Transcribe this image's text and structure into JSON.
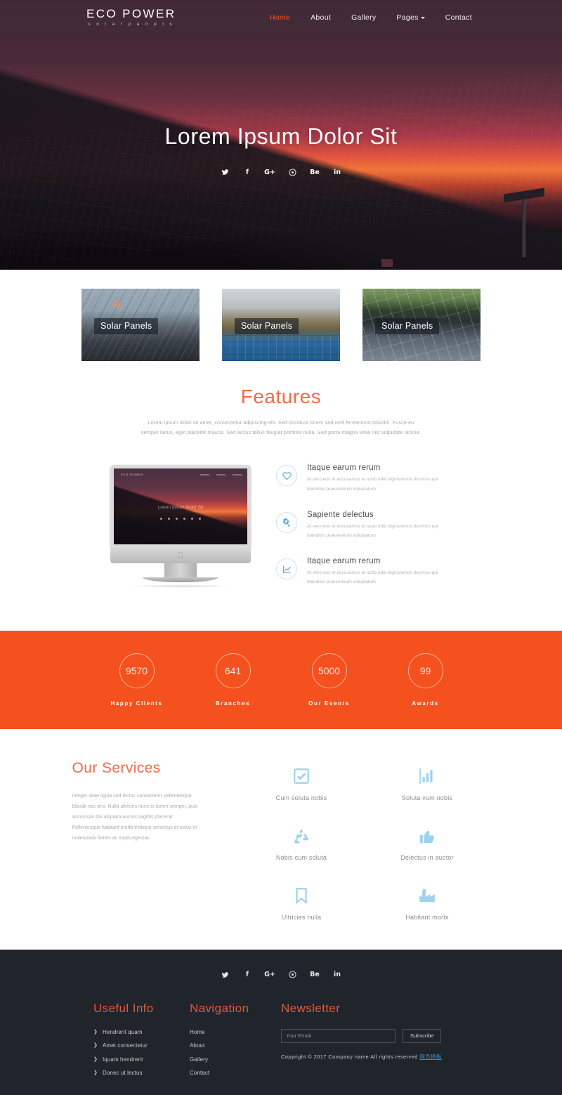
{
  "header": {
    "brand_name": "ECO POWER",
    "brand_tagline": "s o l a r   p a n e l s",
    "nav": [
      {
        "label": "Home",
        "active": true
      },
      {
        "label": "About",
        "active": false
      },
      {
        "label": "Gallery",
        "active": false
      },
      {
        "label": "Pages",
        "active": false,
        "has_caret": true
      },
      {
        "label": "Contact",
        "active": false
      }
    ]
  },
  "hero": {
    "title": "Lorem Ipsum Dolor Sit",
    "social": [
      {
        "name": "twitter-icon",
        "glyph": ""
      },
      {
        "name": "facebook-icon",
        "glyph": "f"
      },
      {
        "name": "google-plus-icon",
        "glyph": "G+"
      },
      {
        "name": "pinterest-icon",
        "glyph": ""
      },
      {
        "name": "behance-icon",
        "glyph": "Be"
      },
      {
        "name": "linkedin-icon",
        "glyph": "in"
      }
    ]
  },
  "cards": [
    {
      "label": "Solar Panels"
    },
    {
      "label": "Solar Panels"
    },
    {
      "label": "Solar Panels"
    }
  ],
  "features": {
    "title": "Features",
    "subtitle": "Lorem ipsum dolor sit amet, consectetur adipiscing elit. Sed tincidunt lorem sed velit fermentum lobortis. Fusce eu semper lacus, eget placerat mauris. Sed lectus tellus feugiat porttitor nulla. Sed porta magna vitae nisl vulputate lacinia.",
    "mockup": {
      "mini_logo": "ECO POWER",
      "mini_title": "Lorem Ipsum Dolor Sit"
    },
    "items": [
      {
        "icon": "heart-icon",
        "title": "Itaque earum rerum",
        "text": "At vero eos et accusamus et iusto odio dignissimos ducimus qui blanditiis praesentium voluptatum"
      },
      {
        "icon": "cogs-icon",
        "title": "Sapiente delectus",
        "text": "At vero eos et accusamus et iusto odio dignissimos ducimus qui blanditiis praesentium voluptatum"
      },
      {
        "icon": "line-chart-icon",
        "title": "Itaque earum rerum",
        "text": "At vero eos et accusamus et iusto odio dignissimos ducimus qui blanditiis praesentium voluptatum"
      }
    ]
  },
  "counters": {
    "background_color": "#f4511e",
    "items": [
      {
        "value": "9570",
        "label": "Happy Clients"
      },
      {
        "value": "641",
        "label": "Branches"
      },
      {
        "value": "5000",
        "label": "Our Events"
      },
      {
        "value": "99",
        "label": "Awards"
      }
    ]
  },
  "services": {
    "title": "Our Services",
    "text": "Integer vitae ligula sed lectus consectetur pellentesque blandit nec orci. Nulla ultricies nunc et lorem semper, quis accumsan dui aliquam auctus sagittis placerat. Pellentesque habitant morbi tristique senectus et netus et malesuada fames ac turpis egestas.",
    "items": [
      {
        "icon": "check-square-icon",
        "name": "Cum soluta nobis"
      },
      {
        "icon": "bar-chart-icon",
        "name": "Soluta vum nobis"
      },
      {
        "icon": "recycle-icon",
        "name": "Nobis cum soluta"
      },
      {
        "icon": "thumbs-up-icon",
        "name": "Delectus in auctor"
      },
      {
        "icon": "bookmark-icon",
        "name": "Ultricies nulla"
      },
      {
        "icon": "industry-icon",
        "name": "Habitant morbi"
      }
    ]
  },
  "footer": {
    "social": [
      {
        "name": "twitter-icon",
        "glyph": ""
      },
      {
        "name": "facebook-icon",
        "glyph": "f"
      },
      {
        "name": "google-plus-icon",
        "glyph": "G+"
      },
      {
        "name": "pinterest-icon",
        "glyph": ""
      },
      {
        "name": "behance-icon",
        "glyph": "Be"
      },
      {
        "name": "linkedin-icon",
        "glyph": "in"
      }
    ],
    "useful_info": {
      "title": "Useful Info",
      "links": [
        "Hendrerit quam",
        "Amet consectetur",
        "Iquam hendrerit",
        "Donec ut lectus"
      ]
    },
    "navigation": {
      "title": "Navigation",
      "links": [
        "Home",
        "About",
        "Gallery",
        "Contact"
      ]
    },
    "newsletter": {
      "title": "Newsletter",
      "email_placeholder": "Your Email",
      "email_value": "",
      "subscribe_label": "Subscribe",
      "copyright": "Copyright © 2017 Company name All rights reserved",
      "copyright_link": "网页模板"
    }
  },
  "colors": {
    "accent_orange": "#f4511e",
    "title_coral": "#f06a4a",
    "icon_blue": "#9ed2ec",
    "footer_bg": "#20242b"
  }
}
